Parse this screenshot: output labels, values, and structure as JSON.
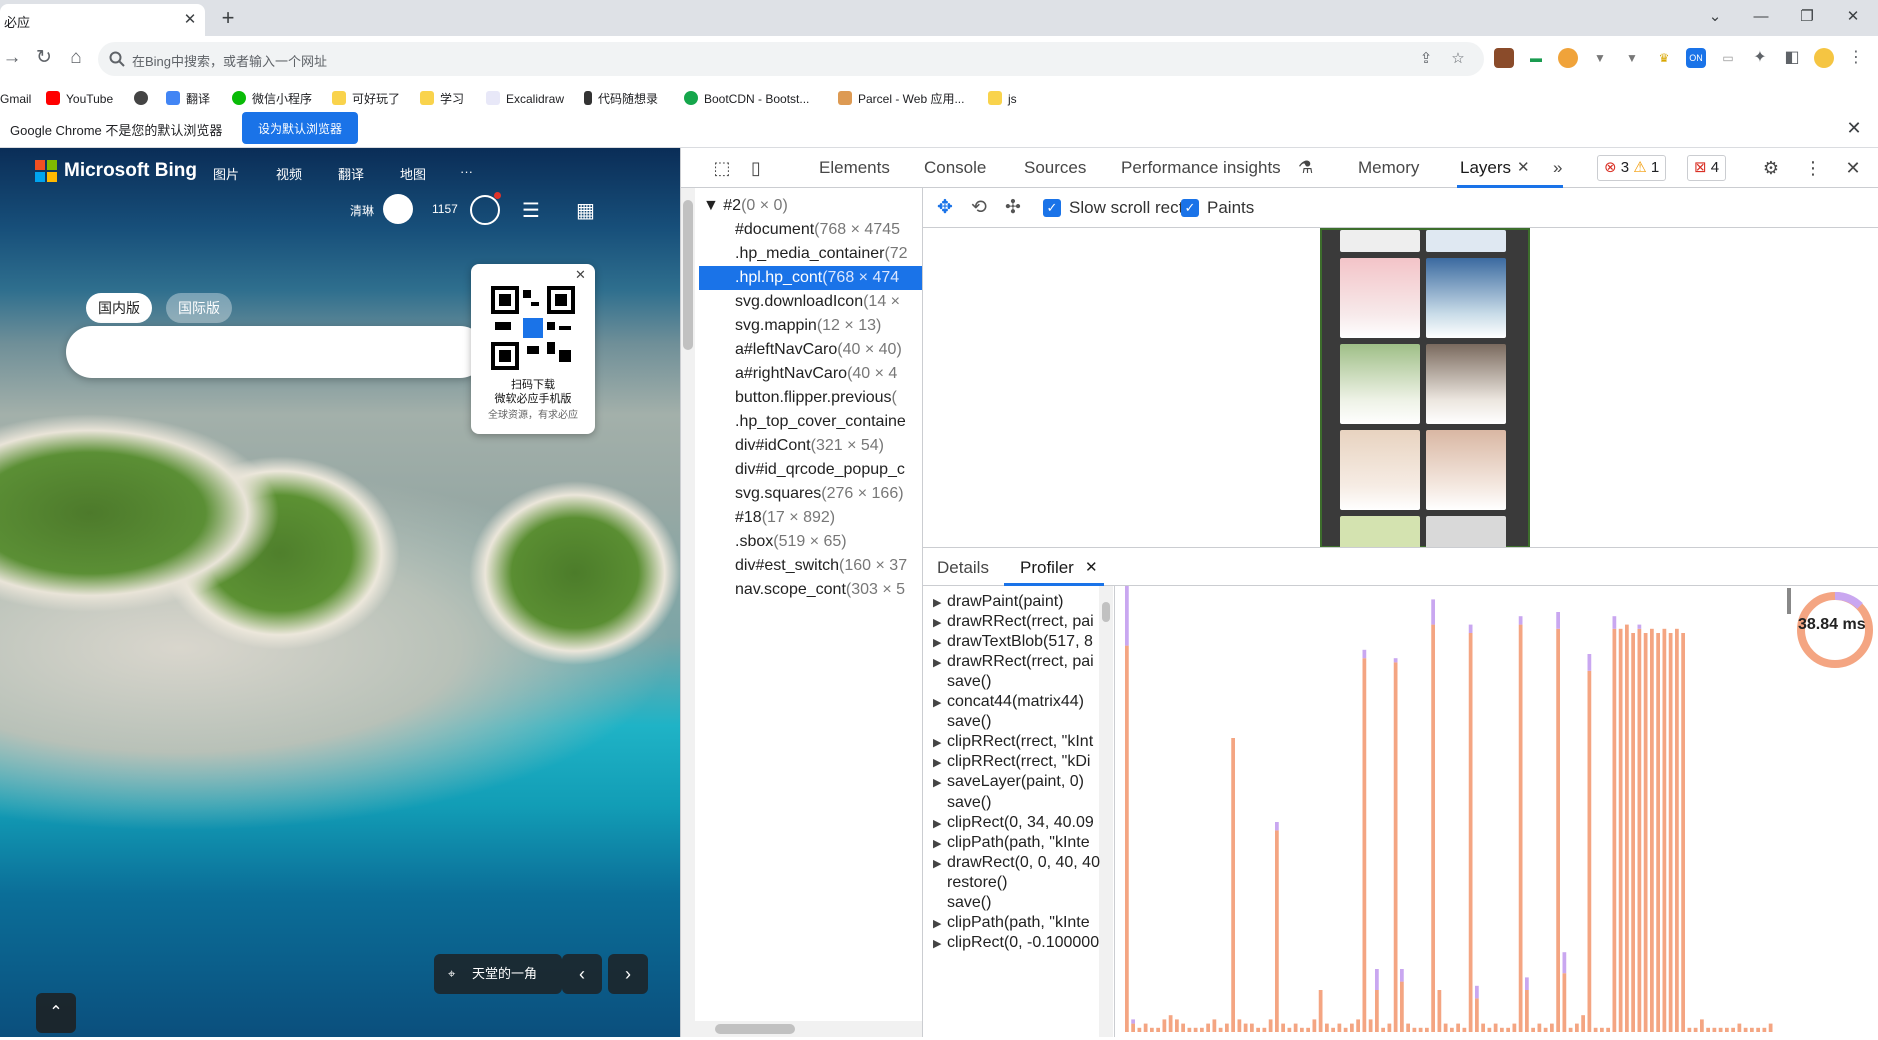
{
  "browser": {
    "tab_title": "必应",
    "tab_close": "✕",
    "new_tab": "+",
    "window_controls": [
      "⌄",
      "—",
      "❐",
      "✕"
    ],
    "address_placeholder": "在Bing中搜索，或者输入一个网址",
    "icons": [
      "back-arrow-icon",
      "reload-icon",
      "home-icon",
      "search-icon",
      "share-icon",
      "star-icon",
      "extensions-icon",
      "sidepanel-icon",
      "profile-icon",
      "menu-icon"
    ],
    "ext_badge": "ON"
  },
  "bookmarks": [
    {
      "label": "Gmail",
      "color": "#ea4335"
    },
    {
      "label": "YouTube",
      "color": "#ff0000"
    },
    {
      "label": "",
      "color": "#5f6368"
    },
    {
      "label": "翻译",
      "color": "#4285f4"
    },
    {
      "label": "微信小程序",
      "color": "#09bb07"
    },
    {
      "label": "可好玩了",
      "color": "#f9d34c"
    },
    {
      "label": "学习",
      "color": "#f9d34c"
    },
    {
      "label": "Excalidraw",
      "color": "#6965db"
    },
    {
      "label": "代码随想录",
      "color": "#333333"
    },
    {
      "label": "BootCDN - Bootst...",
      "color": "#15a64b"
    },
    {
      "label": "Parcel - Web 应用...",
      "color": "#dd9a53"
    },
    {
      "label": "js",
      "color": "#f9d34c"
    }
  ],
  "infobar": {
    "text": "Google Chrome 不是您的默认浏览器",
    "button": "设为默认浏览器",
    "close": "✕"
  },
  "bing": {
    "brand": "Microsoft Bing",
    "nav": [
      "图片",
      "视频",
      "翻译",
      "地图",
      "···"
    ],
    "user_name": "清琳",
    "points": "1157",
    "scope_tabs": [
      "国内版",
      "国际版"
    ],
    "qr": {
      "close": "✕",
      "line1": "扫码下载",
      "line2": "微软必应手机版",
      "line3": "全球资源，有求必应"
    },
    "location": "天堂的一角",
    "prev": "‹",
    "next": "›",
    "up": "⌃"
  },
  "devtools": {
    "tabs": [
      "Elements",
      "Console",
      "Sources",
      "Performance insights",
      "Memory",
      "Layers"
    ],
    "active_tab": "Layers",
    "more": "»",
    "errors": "3",
    "warnings": "1",
    "issues": "4",
    "layer_tree": [
      {
        "name": "▼ #2",
        "dims": "(0 × 0)",
        "indent": 0
      },
      {
        "name": "#document",
        "dims": "(768 × 4745",
        "indent": 1
      },
      {
        "name": ".hp_media_container",
        "dims": "(72",
        "indent": 1
      },
      {
        "name": ".hpl.hp_cont",
        "dims": "(768 × 474",
        "indent": 1,
        "selected": true
      },
      {
        "name": "svg.downloadIcon",
        "dims": "(14 ×",
        "indent": 1
      },
      {
        "name": "svg.mappin",
        "dims": "(12 × 13)",
        "indent": 1
      },
      {
        "name": "a#leftNavCaro",
        "dims": "(40 × 40)",
        "indent": 1
      },
      {
        "name": "a#rightNavCaro",
        "dims": "(40 × 4",
        "indent": 1
      },
      {
        "name": "button.flipper.previous",
        "dims": "(",
        "indent": 1
      },
      {
        "name": ".hp_top_cover_containe",
        "dims": "",
        "indent": 1
      },
      {
        "name": "div#idCont",
        "dims": "(321 × 54)",
        "indent": 1
      },
      {
        "name": "div#id_qrcode_popup_c",
        "dims": "",
        "indent": 1
      },
      {
        "name": "svg.squares",
        "dims": "(276 × 166)",
        "indent": 1
      },
      {
        "name": "#18",
        "dims": "(17 × 892)",
        "indent": 1
      },
      {
        "name": ".sbox",
        "dims": "(519 × 65)",
        "indent": 1
      },
      {
        "name": "div#est_switch",
        "dims": "(160 × 37",
        "indent": 1
      },
      {
        "name": "nav.scope_cont",
        "dims": "(303 × 5",
        "indent": 1
      }
    ],
    "layers_toolbar": {
      "tools": [
        "pan-mode-icon",
        "rotate-mode-icon",
        "reset-transform-icon"
      ],
      "checkbox1": "Slow scroll rects",
      "checkbox2": "Paints"
    },
    "profiler_tabs": [
      "Details",
      "Profiler"
    ],
    "paint_commands": [
      {
        "text": "drawPaint(paint)",
        "expand": true
      },
      {
        "text": "drawRRect(rrect, pai",
        "expand": true
      },
      {
        "text": "drawTextBlob(517, 8",
        "expand": true
      },
      {
        "text": "drawRRect(rrect, pai",
        "expand": true
      },
      {
        "text": "save()",
        "expand": false
      },
      {
        "text": "concat44(matrix44)",
        "expand": true
      },
      {
        "text": "save()",
        "expand": false
      },
      {
        "text": "clipRRect(rrect, \"kInt",
        "expand": true
      },
      {
        "text": "clipRRect(rrect, \"kDi",
        "expand": true
      },
      {
        "text": "saveLayer(paint, 0)",
        "expand": true
      },
      {
        "text": "save()",
        "expand": false
      },
      {
        "text": "clipRect(0, 34, 40.09",
        "expand": true
      },
      {
        "text": "clipPath(path, \"kInte",
        "expand": true
      },
      {
        "text": "drawRect(0, 0, 40, 40",
        "expand": true
      },
      {
        "text": "restore()",
        "expand": false
      },
      {
        "text": "save()",
        "expand": false
      },
      {
        "text": "clipPath(path, \"kInte",
        "expand": true
      },
      {
        "text": "clipRect(0, -0.100000",
        "expand": true
      }
    ],
    "total_time": "38.84 ms"
  },
  "colors": {
    "accent": "#1a73e8",
    "bar_main": "#f4a582",
    "bar_top": "#c9a7f0",
    "pie": "#f4a582"
  },
  "chart_data": {
    "type": "bar",
    "title": "",
    "xlabel": "",
    "ylabel": "",
    "ylim": [
      0,
      100
    ],
    "series": [
      {
        "name": "",
        "values": [
          92,
          2,
          1,
          2,
          1,
          1,
          3,
          4,
          3,
          2,
          1,
          1,
          1,
          2,
          3,
          1,
          2,
          70,
          3,
          2,
          2,
          1,
          1,
          3,
          48,
          2,
          1,
          2,
          1,
          1,
          3,
          10,
          2,
          1,
          2,
          1,
          2,
          3,
          89,
          3,
          10,
          1,
          2,
          88,
          12,
          2,
          1,
          1,
          1,
          97,
          10,
          2,
          1,
          2,
          1,
          95,
          8,
          2,
          1,
          2,
          1,
          1,
          2,
          97,
          10,
          1,
          2,
          1,
          2,
          96,
          14,
          1,
          2,
          4,
          86,
          1,
          1,
          1,
          96,
          96,
          97,
          95,
          96,
          95,
          96,
          95,
          96,
          95,
          96,
          95,
          1,
          1,
          3,
          1,
          1,
          1,
          1,
          1,
          2,
          1,
          1,
          1,
          1,
          2
        ]
      },
      {
        "name": "",
        "values": [
          100,
          1,
          0,
          0,
          0,
          0,
          0,
          0,
          0,
          0,
          0,
          0,
          0,
          0,
          0,
          0,
          0,
          0,
          0,
          0,
          0,
          0,
          0,
          0,
          2,
          0,
          0,
          0,
          0,
          0,
          0,
          0,
          0,
          0,
          0,
          0,
          0,
          0,
          2,
          0,
          5,
          0,
          0,
          1,
          3,
          0,
          0,
          0,
          0,
          6,
          0,
          0,
          0,
          0,
          0,
          2,
          3,
          0,
          0,
          0,
          0,
          0,
          0,
          2,
          3,
          0,
          0,
          0,
          0,
          4,
          5,
          0,
          0,
          0,
          4,
          0,
          0,
          0,
          3,
          0,
          0,
          0,
          1,
          0,
          0,
          0,
          0,
          0,
          0,
          0,
          0,
          0,
          0,
          0,
          0,
          0,
          0,
          0,
          0,
          0,
          0,
          0,
          0,
          0
        ]
      }
    ],
    "pie_total_ms": 38.84
  }
}
